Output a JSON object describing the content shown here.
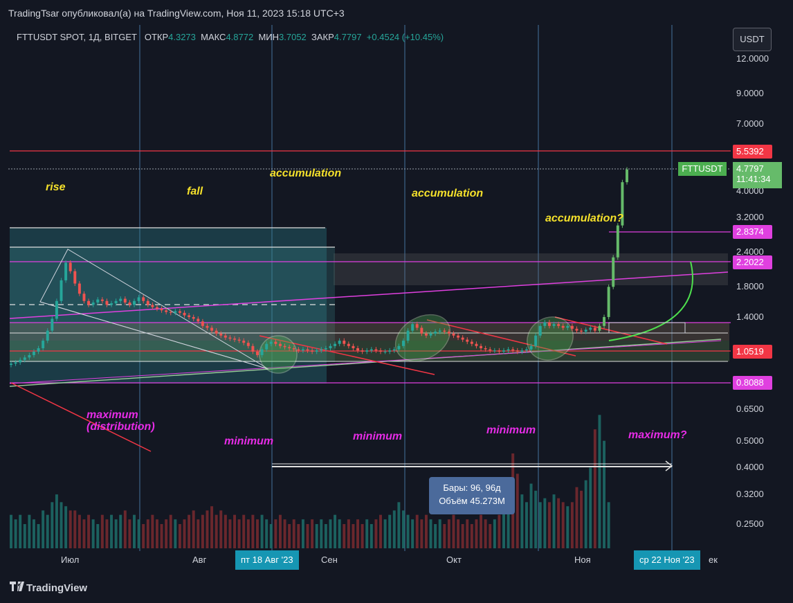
{
  "header": {
    "publisher": "TradingTsar опубликовал(а) на TradingView.com, Ноя 11, 2023 15:18 UTC+3"
  },
  "symbol_line": {
    "symbol": "FTTUSDT SPOT, 1Д, BITGET",
    "open_label": "ОТКР",
    "open": "4.3273",
    "high_label": "МАКС",
    "high": "4.8772",
    "low_label": "МИН",
    "low": "3.7052",
    "close_label": "ЗАКР",
    "close": "4.7797",
    "change": "+0.4524 (+10.45%)"
  },
  "currency_button": "USDT",
  "price_axis": {
    "labels": [
      "12.0000",
      "9.0000",
      "7.0000",
      "4.0000",
      "3.2000",
      "2.4000",
      "1.8000",
      "1.4000",
      "0.6500",
      "0.5000",
      "0.4000",
      "0.3200",
      "0.2500"
    ]
  },
  "price_tags": [
    {
      "text": "5.5392",
      "color": "#f23645"
    },
    {
      "text": "2.8374",
      "color": "#e040e0"
    },
    {
      "text": "2.2022",
      "color": "#e040e0"
    },
    {
      "text": "1.0519",
      "color": "#f23645"
    },
    {
      "text": "0.8088",
      "color": "#e040e0"
    }
  ],
  "last_price": {
    "symbol": "FTTUSDT",
    "price": "4.7797",
    "countdown": "11:41:34"
  },
  "time_axis": {
    "labels": [
      "Июл",
      "Авг",
      "Сен",
      "Окт",
      "Ноя"
    ],
    "highlight_left": "пт 18 Авг '23",
    "highlight_right": "ср 22 Ноя '23",
    "partial_right": "ек"
  },
  "measure_tooltip": {
    "bars": "Бары: 96, 96д",
    "volume": "Объём 45.273M"
  },
  "annotations": {
    "rise": "rise",
    "fall": "fall",
    "accumulation_1": "accumulation",
    "accumulation_2": "accumulation",
    "accumulation_3": "accumulation?",
    "maximum_distribution": "maximum\n(distribution)",
    "minimum_1": "minimum",
    "minimum_2": "minimum",
    "minimum_3": "minimum",
    "maximum_q": "maximum?"
  },
  "footer": {
    "brand": "TradingView"
  },
  "colors": {
    "bull": "#26a69a",
    "bear": "#ef5350",
    "bull_bright": "#66bb6a",
    "resistance": "#f23645",
    "magenta": "#e040e0",
    "annotation_yellow": "#f5e12b",
    "annotation_magenta": "#e62ce6"
  },
  "chart_data": {
    "type": "candlestick",
    "symbol": "FTTUSDT",
    "interval": "1D",
    "y_scale": "log",
    "ylim": [
      0.22,
      14.0
    ],
    "closes": [
      0.95,
      0.96,
      0.98,
      1.0,
      1.02,
      1.05,
      1.08,
      1.15,
      1.25,
      1.38,
      1.6,
      1.9,
      2.2,
      2.05,
      1.85,
      1.7,
      1.6,
      1.55,
      1.58,
      1.62,
      1.6,
      1.55,
      1.57,
      1.6,
      1.63,
      1.58,
      1.55,
      1.6,
      1.65,
      1.6,
      1.55,
      1.52,
      1.5,
      1.48,
      1.46,
      1.45,
      1.47,
      1.45,
      1.42,
      1.4,
      1.38,
      1.35,
      1.3,
      1.28,
      1.25,
      1.22,
      1.2,
      1.18,
      1.17,
      1.16,
      1.15,
      1.13,
      1.1,
      1.05,
      1.02,
      1.07,
      1.12,
      1.14,
      1.12,
      1.1,
      1.09,
      1.08,
      1.07,
      1.06,
      1.07,
      1.06,
      1.05,
      1.06,
      1.07,
      1.08,
      1.1,
      1.12,
      1.15,
      1.12,
      1.1,
      1.08,
      1.06,
      1.05,
      1.06,
      1.07,
      1.06,
      1.05,
      1.05,
      1.06,
      1.07,
      1.1,
      1.15,
      1.25,
      1.32,
      1.28,
      1.22,
      1.2,
      1.22,
      1.24,
      1.25,
      1.24,
      1.22,
      1.2,
      1.18,
      1.16,
      1.14,
      1.12,
      1.1,
      1.08,
      1.07,
      1.06,
      1.06,
      1.05,
      1.06,
      1.07,
      1.06,
      1.05,
      1.06,
      1.07,
      1.1,
      1.2,
      1.3,
      1.34,
      1.3,
      1.32,
      1.3,
      1.28,
      1.3,
      1.27,
      1.25,
      1.24,
      1.26,
      1.28,
      1.25,
      1.3,
      1.4,
      1.8,
      2.3,
      3.0,
      4.3,
      4.78
    ],
    "volume": [
      0.27,
      0.26,
      0.27,
      0.25,
      0.27,
      0.26,
      0.25,
      0.28,
      0.27,
      0.3,
      0.32,
      0.3,
      0.29,
      0.28,
      0.28,
      0.27,
      0.26,
      0.27,
      0.26,
      0.25,
      0.27,
      0.26,
      0.27,
      0.26,
      0.27,
      0.28,
      0.26,
      0.27,
      0.26,
      0.25,
      0.26,
      0.27,
      0.26,
      0.25,
      0.26,
      0.27,
      0.26,
      0.25,
      0.26,
      0.27,
      0.28,
      0.26,
      0.27,
      0.28,
      0.29,
      0.27,
      0.28,
      0.27,
      0.26,
      0.27,
      0.26,
      0.27,
      0.26,
      0.27,
      0.26,
      0.27,
      0.26,
      0.25,
      0.26,
      0.27,
      0.26,
      0.25,
      0.26,
      0.25,
      0.26,
      0.25,
      0.26,
      0.25,
      0.26,
      0.25,
      0.26,
      0.27,
      0.26,
      0.25,
      0.26,
      0.25,
      0.26,
      0.25,
      0.26,
      0.25,
      0.26,
      0.27,
      0.26,
      0.27,
      0.28,
      0.3,
      0.28,
      0.27,
      0.26,
      0.27,
      0.26,
      0.27,
      0.26,
      0.25,
      0.26,
      0.25,
      0.26,
      0.27,
      0.26,
      0.25,
      0.26,
      0.25,
      0.26,
      0.27,
      0.26,
      0.25,
      0.26,
      0.27,
      0.28,
      0.3,
      0.45,
      0.38,
      0.32,
      0.3,
      0.35,
      0.33,
      0.3,
      0.31,
      0.3,
      0.32,
      0.31,
      0.3,
      0.29,
      0.3,
      0.34,
      0.33,
      0.36,
      0.4,
      0.55,
      0.62,
      0.5,
      0.3
    ]
  }
}
